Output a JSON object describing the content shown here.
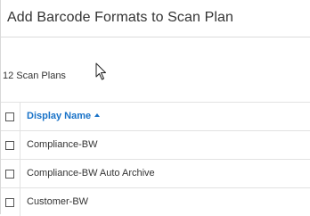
{
  "dialog": {
    "title": "Add Barcode Formats to Scan Plan",
    "scan_plan_count": "12 Scan Plans"
  },
  "table": {
    "header": {
      "display_name": "Display Name"
    },
    "rows": [
      {
        "name": "Compliance-BW"
      },
      {
        "name": "Compliance-BW Auto Archive"
      },
      {
        "name": "Customer-BW"
      }
    ]
  },
  "icons": {
    "sort": "sort-ascending-icon",
    "cursor": "mouse-pointer-icon"
  },
  "colors": {
    "header_link": "#1a73c8",
    "text": "#333333",
    "border": "#e2e2e2"
  }
}
